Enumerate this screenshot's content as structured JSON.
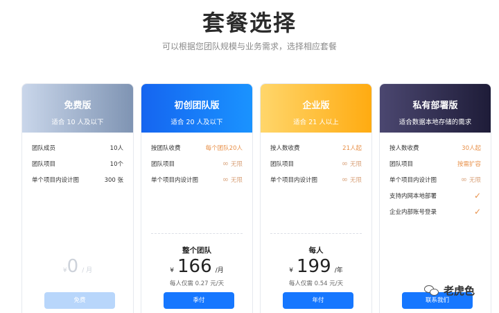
{
  "header": {
    "title": "套餐选择",
    "subtitle": "可以根据您团队规模与业务需求，选择相应套餐"
  },
  "plans": [
    {
      "name": "免费版",
      "desc": "适合 10 人及以下",
      "features": [
        {
          "label": "团队成员",
          "value": "10人"
        },
        {
          "label": "团队项目",
          "value": "10个"
        },
        {
          "label": "单个项目内设计图",
          "value": "300 张"
        }
      ],
      "price": {
        "currency": "¥",
        "amount": "0",
        "unit": "/ 月"
      },
      "button": "免费"
    },
    {
      "name": "初创团队版",
      "desc": "适合 20 人及以下",
      "features": [
        {
          "label": "按团队收费",
          "value": "每个团队20人"
        },
        {
          "label": "团队项目",
          "value": "无限"
        },
        {
          "label": "单个项目内设计图",
          "value": "无限"
        }
      ],
      "price": {
        "label": "整个团队",
        "currency": "¥",
        "amount": "166",
        "unit": "/月",
        "sub": "每人仅需 0.27 元/天"
      },
      "button": "季付"
    },
    {
      "name": "企业版",
      "desc": "适合 21 人以上",
      "features": [
        {
          "label": "按人数收费",
          "value": "21人起"
        },
        {
          "label": "团队项目",
          "value": "无限"
        },
        {
          "label": "单个项目内设计图",
          "value": "无限"
        }
      ],
      "price": {
        "label": "每人",
        "currency": "¥",
        "amount": "199",
        "unit": "/年",
        "sub": "每人仅需 0.54 元/天"
      },
      "button": "年付"
    },
    {
      "name": "私有部署版",
      "desc": "适合数据本地存储的需求",
      "features": [
        {
          "label": "按人数收费",
          "value": "30人起"
        },
        {
          "label": "团队项目",
          "value": "按需扩容"
        },
        {
          "label": "单个项目内设计图",
          "value": "无限"
        },
        {
          "label": "支持内网本地部署"
        },
        {
          "label": "企业内部账号登录"
        }
      ],
      "button": "联系我们"
    }
  ],
  "watermark": {
    "text": "老虎色"
  },
  "icons": {
    "infinity": "∞",
    "check": "✓"
  }
}
